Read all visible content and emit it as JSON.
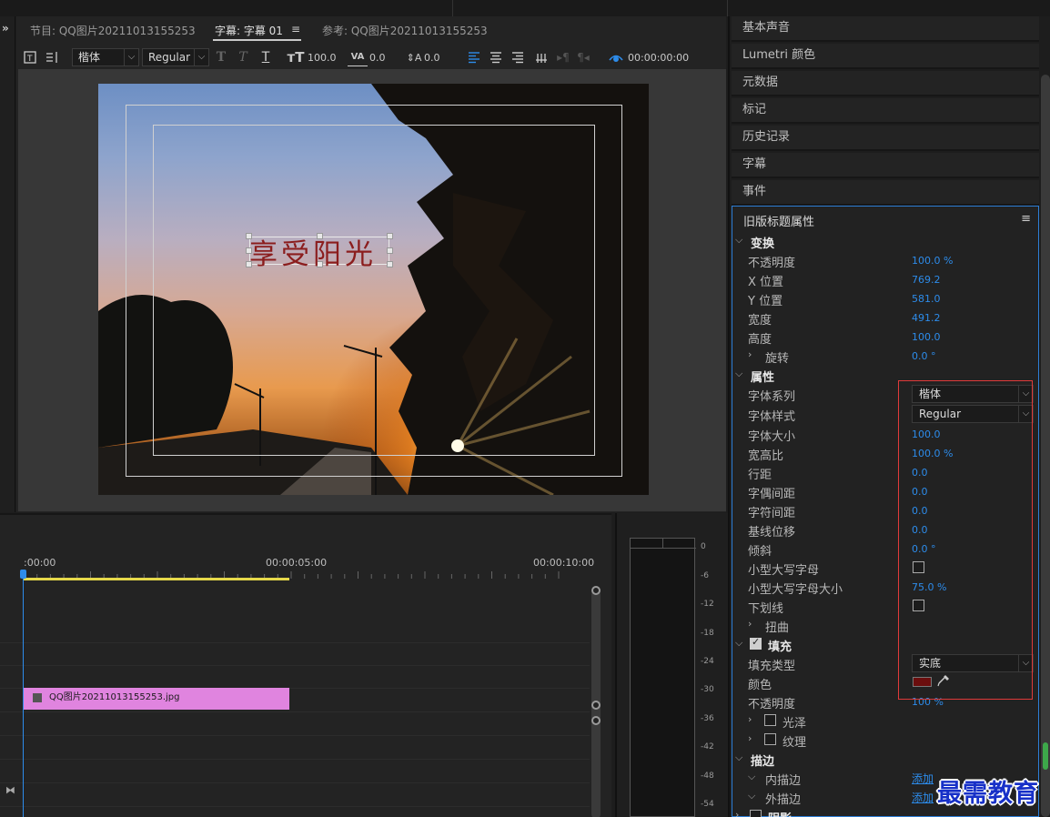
{
  "tabs": {
    "program": "节目: QQ图片20211013155253",
    "captions": "字幕: 字幕 01",
    "reference": "参考: QQ图片20211013155253"
  },
  "toolbar": {
    "font_family": "楷体",
    "font_style": "Regular",
    "font_size": "100.0",
    "kerning": "0.0",
    "leading": "0.0",
    "timecode": "00:00:00:00"
  },
  "monitor": {
    "title_text": "享受阳光"
  },
  "timeline": {
    "times": [
      ":00:00",
      "00:00:05:00",
      "00:00:10:00"
    ],
    "clip_name": "QQ图片20211013155253.jpg"
  },
  "meter": {
    "db_ticks": [
      "0",
      "-6",
      "-12",
      "-18",
      "-24",
      "-30",
      "-36",
      "-42",
      "-48",
      "-54"
    ]
  },
  "panels": [
    "基本声音",
    "Lumetri 颜色",
    "元数据",
    "标记",
    "历史记录",
    "字幕",
    "事件"
  ],
  "legacy": {
    "title": "旧版标题属性",
    "transform": {
      "header": "变换",
      "opacity_label": "不透明度",
      "opacity": "100.0 %",
      "xpos_label": "X 位置",
      "xpos": "769.2",
      "ypos_label": "Y 位置",
      "ypos": "581.0",
      "width_label": "宽度",
      "width": "491.2",
      "height_label": "高度",
      "height": "100.0",
      "rotation_label": "旋转",
      "rotation": "0.0 °"
    },
    "properties": {
      "header": "属性",
      "font_family_label": "字体系列",
      "font_family": "楷体",
      "font_style_label": "字体样式",
      "font_style": "Regular",
      "font_size_label": "字体大小",
      "font_size": "100.0",
      "aspect_label": "宽高比",
      "aspect": "100.0 %",
      "leading_label": "行距",
      "leading": "0.0",
      "kerning_label": "字偶间距",
      "kerning": "0.0",
      "tracking_label": "字符间距",
      "tracking": "0.0",
      "baseline_label": "基线位移",
      "baseline": "0.0",
      "slant_label": "倾斜",
      "slant": "0.0 °",
      "smallcaps_label": "小型大写字母",
      "smallcaps_size_label": "小型大写字母大小",
      "smallcaps_size": "75.0 %",
      "underline_label": "下划线",
      "distort_label": "扭曲"
    },
    "fill": {
      "header": "填充",
      "type_label": "填充类型",
      "type": "实底",
      "color_label": "颜色",
      "color": "#6b0e0e",
      "opacity_label": "不透明度",
      "opacity": "100 %",
      "sheen_label": "光泽",
      "texture_label": "纹理"
    },
    "stroke": {
      "header": "描边",
      "inner_label": "内描边",
      "inner_add": "添加",
      "outer_label": "外描边",
      "outer_add": "添加"
    },
    "shadow": {
      "header": "阴影"
    }
  },
  "watermark": "最需教育"
}
